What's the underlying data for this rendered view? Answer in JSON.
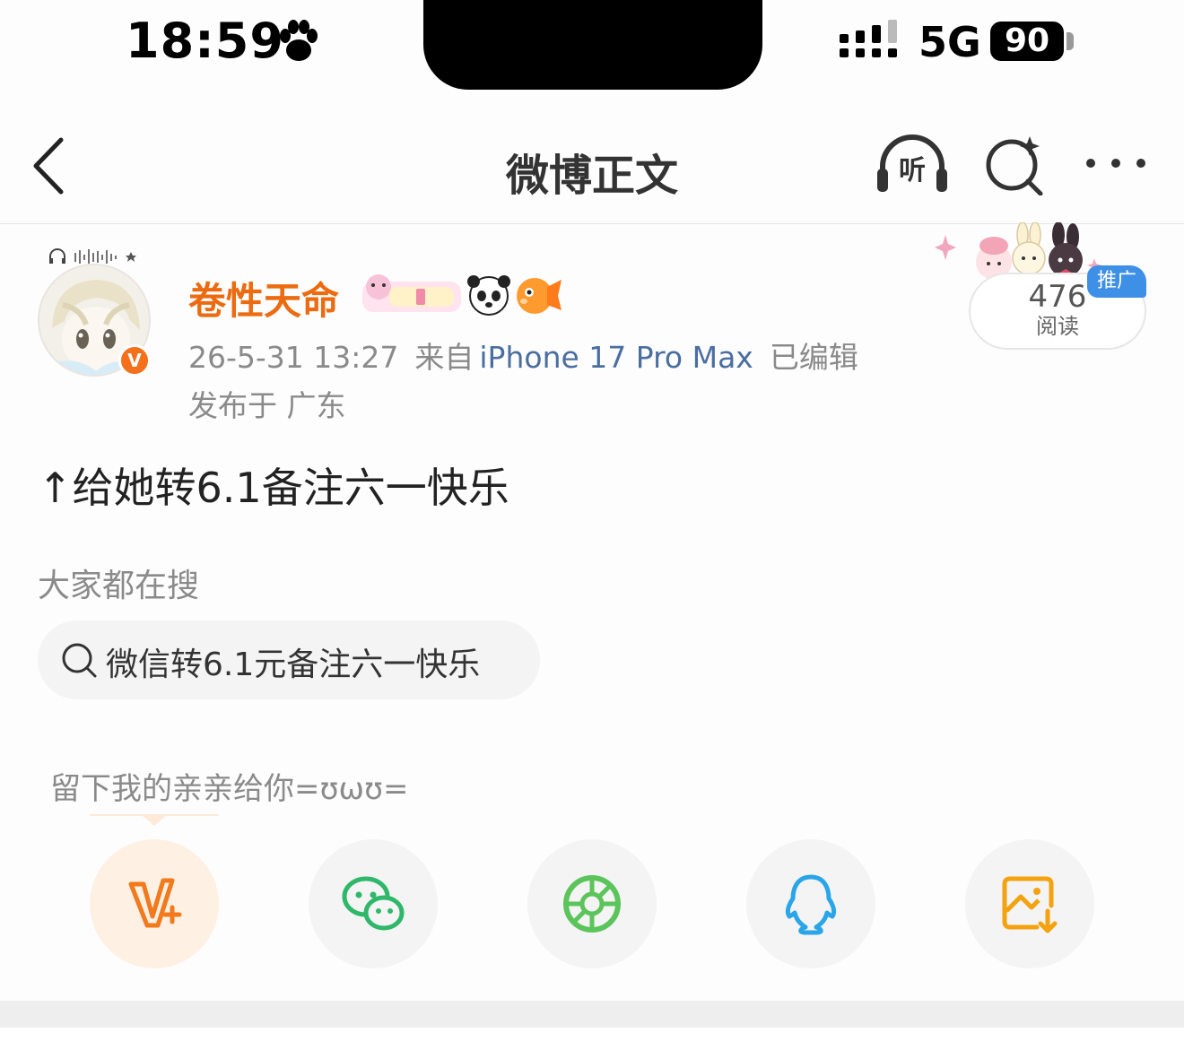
{
  "status_bar": {
    "time": "18:59",
    "network": "5G",
    "battery": "90"
  },
  "nav": {
    "title": "微博正文",
    "listen_icon_text": "听"
  },
  "author": {
    "name": "卷性天命",
    "verified_badge": "V",
    "timestamp": "26-5-31 13:27",
    "source_prefix": "来自",
    "device": "iPhone 17 Pro Max",
    "edited": "已编辑",
    "location": "发布于 广东"
  },
  "reads": {
    "count": "476",
    "label": "阅读",
    "promo": "推广"
  },
  "post": {
    "text": "↑给她转6.1备注六一快乐"
  },
  "hot_search": {
    "label": "大家都在搜",
    "query": "微信转6.1元备注六一快乐"
  },
  "share": {
    "prompt": "留下我的亲亲给你=ʊωʊ="
  },
  "colors": {
    "username": "#ec6b11",
    "device_link": "#4a6ea0",
    "promo": "#3e8fe6",
    "wechat": "#2fb86a",
    "moments": "#5bc45a",
    "qq": "#2aa5e8",
    "save": "#f4a20f"
  }
}
